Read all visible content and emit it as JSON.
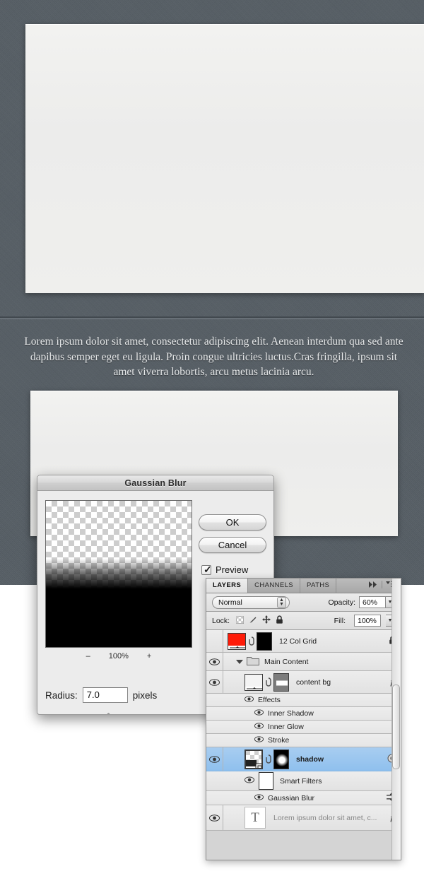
{
  "page": {
    "body_copy": "Lorem ipsum dolor sit amet, consectetur adipiscing elit. Aenean interdum qua sed ante dapibus semper eget eu ligula. Proin congue ultricies luctus.Cras fringilla, ipsum sit amet viverra lobortis, arcu metus lacinia arcu.",
    "bg_color": "#555d64",
    "box_color": "#efefed"
  },
  "dialog": {
    "title": "Gaussian Blur",
    "ok_label": "OK",
    "cancel_label": "Cancel",
    "preview_label": "Preview",
    "preview_checked": true,
    "zoom_out_label": "–",
    "zoom_value": "100%",
    "zoom_in_label": "+",
    "radius_label": "Radius:",
    "radius_value": "7.0",
    "radius_units": "pixels",
    "slider_position_pct": 31
  },
  "layers_panel": {
    "tabs": [
      {
        "label": "LAYERS",
        "active": true
      },
      {
        "label": "CHANNELS",
        "active": false
      },
      {
        "label": "PATHS",
        "active": false
      }
    ],
    "collapse_icon": "double-arrow-right-icon",
    "menu_icon": "panel-menu-icon",
    "blend_mode": "Normal",
    "opacity_label": "Opacity:",
    "opacity_value": "60%",
    "lock_label": "Lock:",
    "lock_icons": [
      "lock-transparency-icon",
      "lock-image-icon",
      "lock-position-icon",
      "lock-all-icon"
    ],
    "fill_label": "Fill:",
    "fill_value": "100%",
    "layers": [
      {
        "name": "12 Col Grid",
        "type": "layer",
        "indent": 0,
        "visible": false,
        "selected": false,
        "thumb": "red",
        "has_mask": true,
        "mask": "black",
        "linked": true,
        "right_icon": "lock-icon"
      },
      {
        "name": "Main Content",
        "type": "group",
        "indent": 0,
        "visible": true,
        "selected": false,
        "expanded": true,
        "right_icon": ""
      },
      {
        "name": "content bg",
        "type": "layer",
        "indent": 1,
        "visible": true,
        "selected": false,
        "thumb": "white",
        "has_mask": true,
        "mask": "grey-bar",
        "linked": true,
        "right_icon": "fx-icon"
      },
      {
        "name": "Effects",
        "type": "effects-header",
        "indent": 2,
        "visible": true,
        "selected": false
      },
      {
        "name": "Inner Shadow",
        "type": "effect",
        "indent": 3,
        "visible": true,
        "selected": false
      },
      {
        "name": "Inner Glow",
        "type": "effect",
        "indent": 3,
        "visible": true,
        "selected": false
      },
      {
        "name": "Stroke",
        "type": "effect",
        "indent": 3,
        "visible": true,
        "selected": false
      },
      {
        "name": "shadow",
        "type": "layer",
        "indent": 1,
        "visible": true,
        "selected": true,
        "thumb": "checker-smart",
        "has_mask": true,
        "mask": "white-blob",
        "linked": true,
        "right_icon": "smart-filter-icon"
      },
      {
        "name": "Smart Filters",
        "type": "smart-filters",
        "indent": 2,
        "visible": true,
        "selected": false
      },
      {
        "name": "Gaussian Blur",
        "type": "smart-filter",
        "indent": 3,
        "visible": true,
        "selected": false,
        "right_icon": "blending-options-icon"
      },
      {
        "name": "Lorem ipsum dolor sit amet, c...",
        "type": "text-layer",
        "indent": 1,
        "visible": true,
        "selected": false,
        "thumb": "type",
        "right_icon": "fx-icon"
      }
    ]
  }
}
